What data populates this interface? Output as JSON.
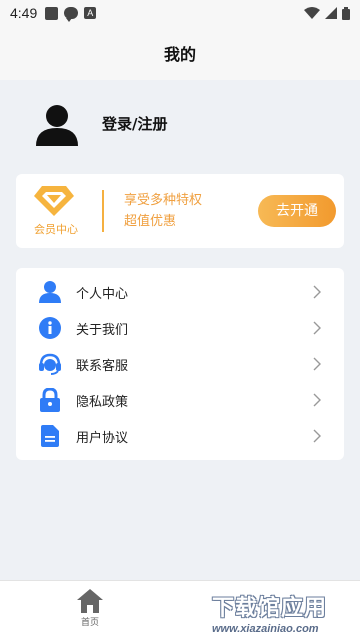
{
  "status_bar": {
    "time": "4:49",
    "icons_left": [
      "square-icon",
      "message-icon",
      "a-icon"
    ],
    "icons_right": [
      "wifi-icon",
      "signal-icon",
      "battery-icon"
    ]
  },
  "header": {
    "title": "我的"
  },
  "profile": {
    "avatar": "person-icon",
    "login_label": "登录/注册"
  },
  "vip": {
    "label": "会员中心",
    "desc_line1": "享受多种特权",
    "desc_line2": "超值优惠",
    "button": "去开通",
    "accent_color": "#f29a2e"
  },
  "menu": {
    "items": [
      {
        "label": "个人中心",
        "icon": "user-icon"
      },
      {
        "label": "关于我们",
        "icon": "info-icon"
      },
      {
        "label": "联系客服",
        "icon": "headset-icon"
      },
      {
        "label": "隐私政策",
        "icon": "lock-icon"
      },
      {
        "label": "用户协议",
        "icon": "document-icon"
      }
    ],
    "icon_color": "#2f7cf6"
  },
  "tabbar": {
    "home_label": "首页"
  },
  "watermark": {
    "main": "下载馆应用",
    "sub": "www.xiazainiao.com"
  }
}
